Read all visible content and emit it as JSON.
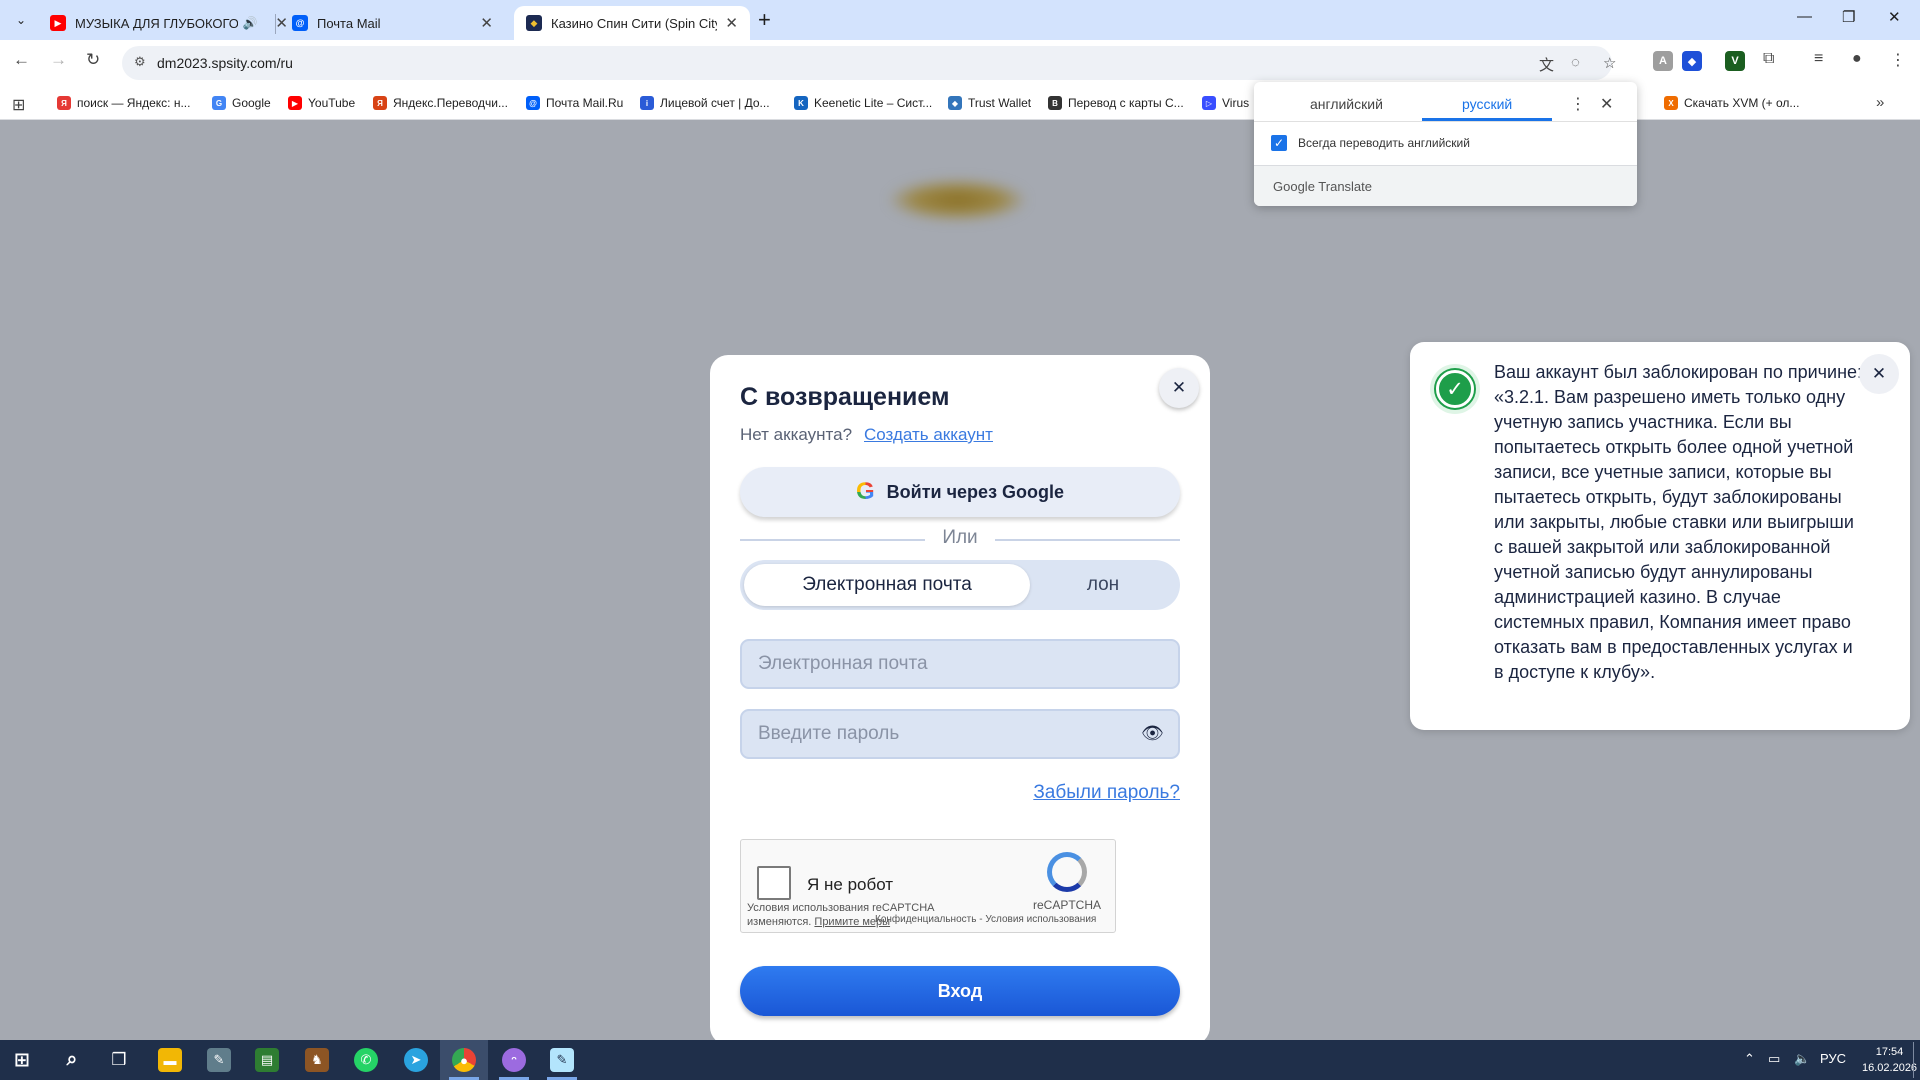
{
  "browser": {
    "tabs": [
      {
        "title": "МУЗЫКА ДЛЯ ГЛУБОКОГО",
        "favicon": "youtube-icon",
        "audio": true,
        "active": false
      },
      {
        "title": "Почта Mail",
        "favicon": "mail-icon",
        "active": false
      },
      {
        "title": "Казино Спин Сити (Spin City) с",
        "favicon": "spincity-icon",
        "active": true
      }
    ],
    "url": "dm2023.spsity.com/ru",
    "bookmarks": [
      {
        "label": "поиск — Яндекс: н...",
        "icon": "yandex-icon",
        "color": "#e53935"
      },
      {
        "label": "Google",
        "icon": "google-icon",
        "color": "#4285f4"
      },
      {
        "label": "YouTube",
        "icon": "youtube-icon",
        "color": "#ff0000"
      },
      {
        "label": "Яндекс.Переводчи...",
        "icon": "translator-icon",
        "color": "#d84315"
      },
      {
        "label": "Почта Mail.Ru",
        "icon": "mail-icon",
        "color": "#005ff9"
      },
      {
        "label": "Лицевой счет | До...",
        "icon": "info-icon",
        "color": "#2a5bd7"
      },
      {
        "label": "Keenetic Lite – Сист...",
        "icon": "keenetic-icon",
        "color": "#1565c0"
      },
      {
        "label": "Trust Wallet",
        "icon": "shield-icon",
        "color": "#3375bb"
      },
      {
        "label": "Перевод с карты С...",
        "icon": "bc-icon",
        "color": "#333333"
      },
      {
        "label": "Virus",
        "icon": "virustotal-icon",
        "color": "#394eff"
      },
      {
        "label": "Скачать XVM (+ ол...",
        "icon": "xvm-icon",
        "color": "#ef6c00"
      }
    ]
  },
  "translate_popup": {
    "source_lang": "английский",
    "target_lang": "русский",
    "always_translate": "Всегда переводить английский",
    "footer": "Google Translate"
  },
  "login": {
    "title": "С возвращением",
    "no_account": "Нет аккаунта?",
    "create_account": "Создать аккаунт",
    "google_button": "Войти через Google",
    "or": "Или",
    "tab_email": "Электронная почта",
    "tab_phone": "лон",
    "email_placeholder": "Электронная почта",
    "password_placeholder": "Введите пароль",
    "forgot": "Забыли пароль?",
    "captcha_label": "Я не робот",
    "captcha_brand": "reCAPTCHA",
    "captcha_fine1": "Условия использования reCAPTCHA",
    "captcha_fine2_prefix": "изменяются.",
    "captcha_fine2_link": "Примите меры",
    "captcha_privacy": "Конфиденциальность - Условия использования",
    "submit": "Вход"
  },
  "notification": {
    "text": "Ваш аккаунт был заблокирован по причине: «3.2.1. Вам разрешено иметь только одну учетную запись участника. Если вы попытаетесь открыть более одной учетной записи, все учетные записи, которые вы пытаетесь открыть, будут заблокированы или закрыты, любые ставки или выигрыши с вашей закрытой или заблокированной учетной записью будут аннулированы администрацией казино. В случае системных правил, Компания имеет право отказать вам в предоставленных услугах и в доступе к клубу»."
  },
  "taskbar": {
    "lang": "РУС",
    "time": "17:54",
    "date": "16.02.2026"
  },
  "colors": {
    "accent": "#1a57d6",
    "link": "#3a7ae0",
    "success": "#1e9e4a",
    "overlay": "#a5a9b1"
  }
}
